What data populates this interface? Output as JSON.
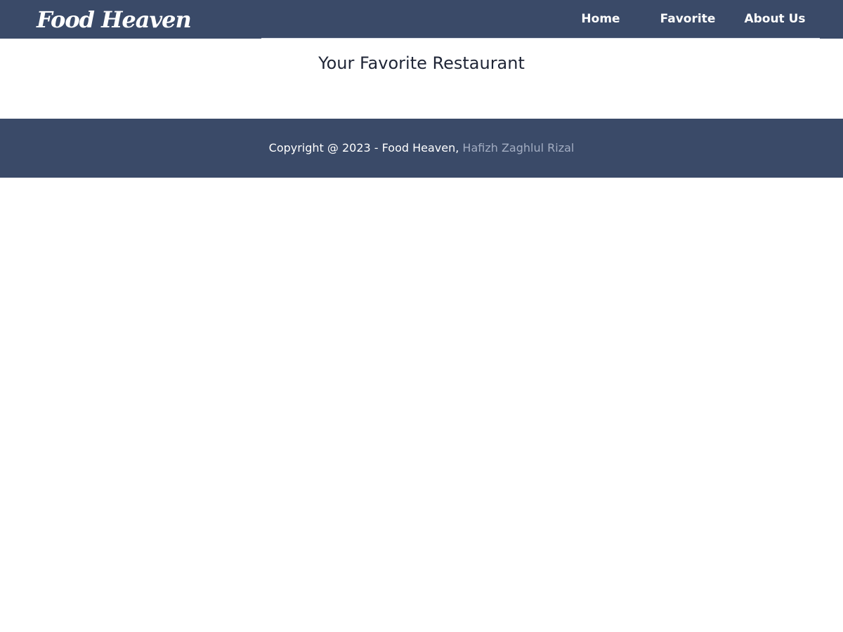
{
  "header": {
    "brand": "Food Heaven",
    "nav": [
      {
        "label": "Home"
      },
      {
        "label": "Favorite"
      },
      {
        "label": "About Us"
      }
    ]
  },
  "main": {
    "title": "Your Favorite Restaurant"
  },
  "footer": {
    "copyright": "Copyright @ 2023 - Food Heaven, ",
    "author": "Hafizh Zaghlul Rizal"
  },
  "colors": {
    "bar_background": "#3a4a68",
    "text_light": "#ffffff",
    "author_link": "#a3adc2",
    "title_text": "#1f2536"
  }
}
